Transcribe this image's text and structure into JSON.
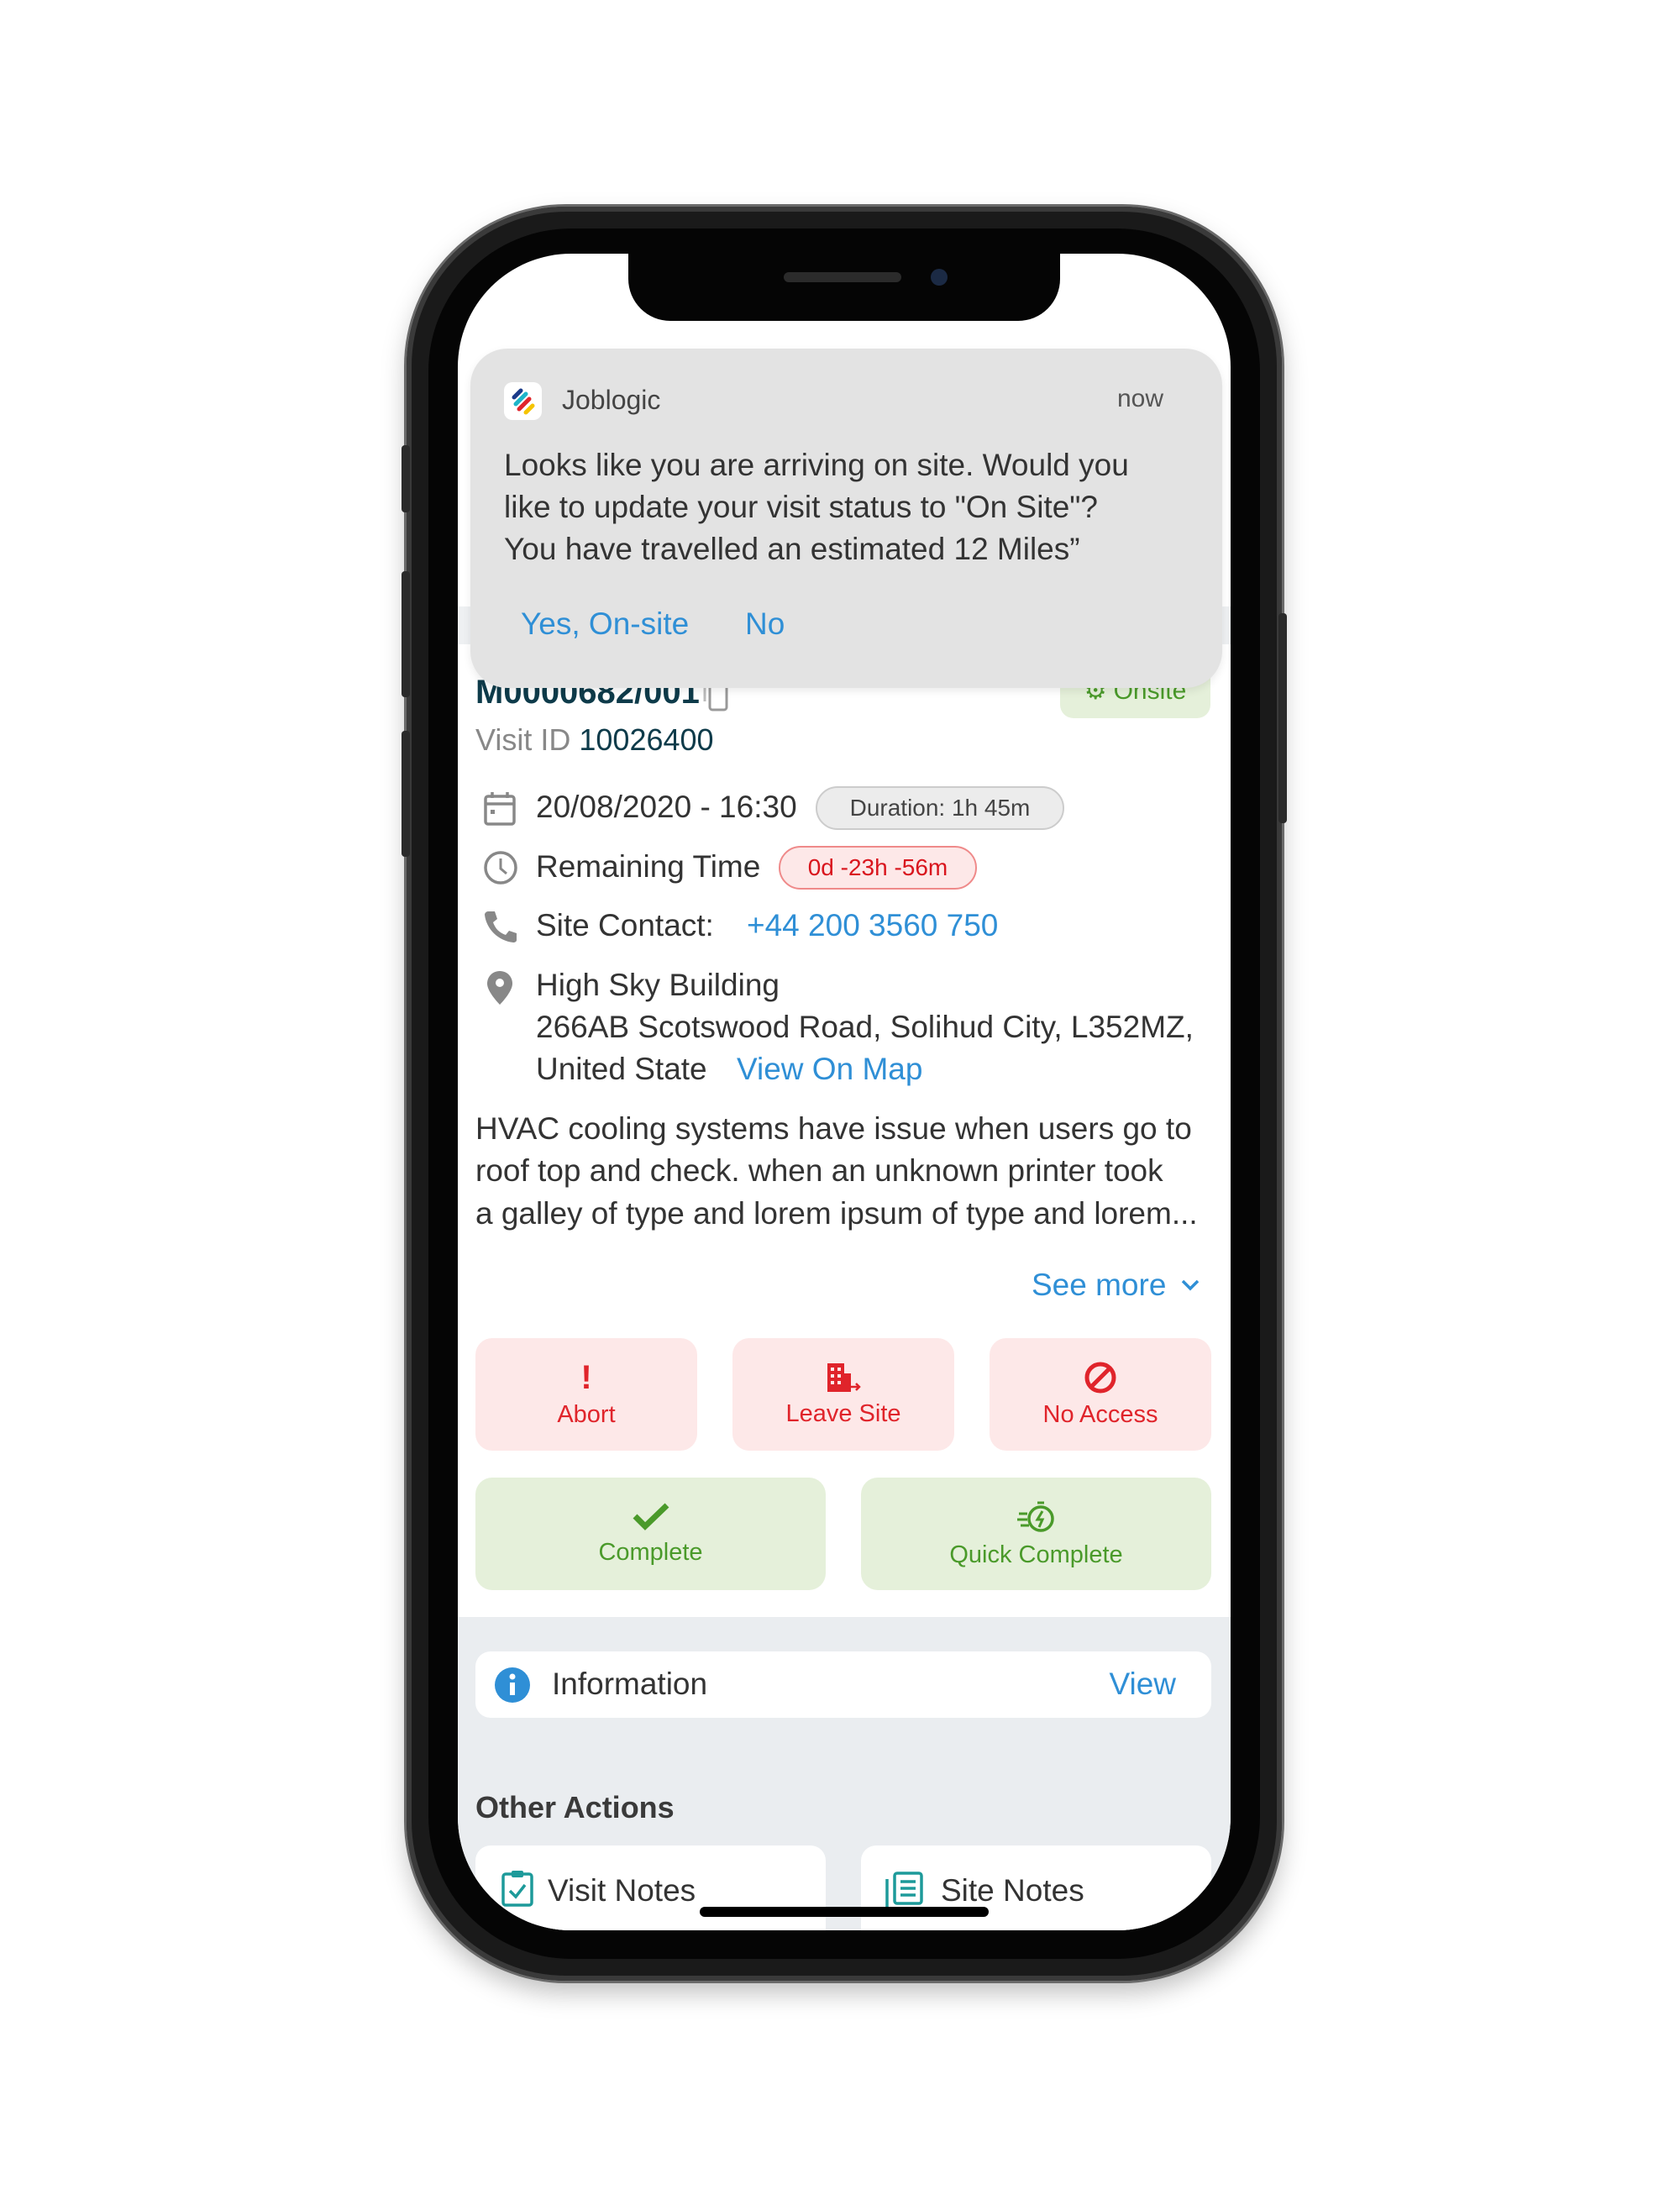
{
  "notification": {
    "app_name": "Joblogic",
    "time": "now",
    "message_lines": [
      "Looks like you are arriving on site. Would you",
      "like to update your visit status to \"On Site\"?",
      "You have travelled an estimated 12 Miles”"
    ],
    "actions": {
      "yes": "Yes, On-site",
      "no": "No"
    }
  },
  "job": {
    "number": "M0000682/001",
    "status": "Onsite",
    "visit_id_label": "Visit ID",
    "visit_id": "10026400",
    "datetime": "20/08/2020 - 16:30",
    "duration": "Duration: 1h 45m",
    "remaining_label": "Remaining Time",
    "remaining": "0d -23h -56m",
    "site_contact_label": "Site Contact:",
    "site_contact_phone": "+44 200 3560 750",
    "address_lines": [
      "High Sky Building",
      "266AB Scotswood Road, Solihud City, L352MZ,",
      "United State"
    ],
    "view_on_map": "View On Map",
    "description_lines": [
      "HVAC cooling systems have issue when users go to",
      "roof top and check. when an unknown printer took",
      "a galley of type and lorem ipsum of type and lorem..."
    ],
    "see_more": "See more"
  },
  "actions": {
    "abort": "Abort",
    "leave_site": "Leave Site",
    "no_access": "No Access",
    "complete": "Complete",
    "quick_complete": "Quick Complete"
  },
  "information": {
    "label": "Information",
    "view": "View"
  },
  "other_actions": {
    "title": "Other Actions",
    "items": [
      {
        "label": "Visit Notes",
        "icon": "clipboard-check-icon"
      },
      {
        "label": "Site Notes",
        "icon": "notes-list-icon"
      }
    ]
  },
  "colors": {
    "accent": "#2f8fd6",
    "danger": "#e0242b",
    "success": "#4a9a2a",
    "navy": "#0e3b4a"
  }
}
